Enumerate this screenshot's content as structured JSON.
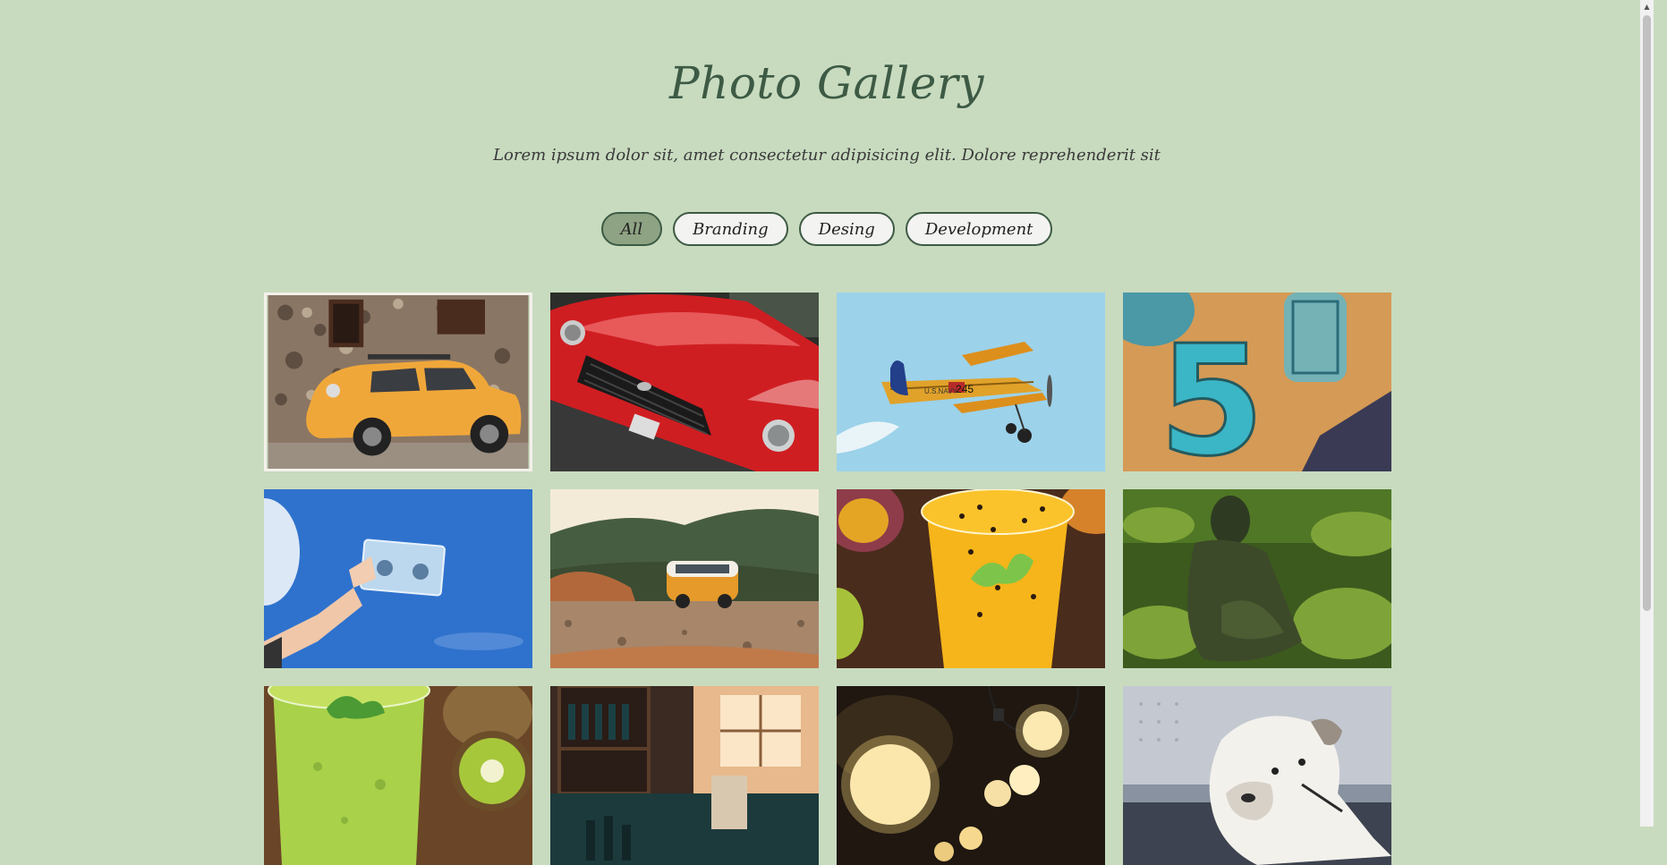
{
  "header": {
    "title": "Photo Gallery",
    "subtitle": "Lorem ipsum dolor sit, amet consectetur adipisicing elit. Dolore reprehenderit sit"
  },
  "filters": [
    {
      "label": "All",
      "active": true
    },
    {
      "label": "Branding",
      "active": false
    },
    {
      "label": "Desing",
      "active": false
    },
    {
      "label": "Development",
      "active": false
    }
  ],
  "gallery": {
    "items": [
      {
        "name": "yellow-vintage-car",
        "selected": true
      },
      {
        "name": "red-mustang"
      },
      {
        "name": "biplane-245"
      },
      {
        "name": "number-five"
      },
      {
        "name": "cassette-in-hand"
      },
      {
        "name": "vw-van-mountains"
      },
      {
        "name": "passion-fruit-drink"
      },
      {
        "name": "mossy-buddha-statue"
      },
      {
        "name": "kiwi-smoothie"
      },
      {
        "name": "rustic-kitchen"
      },
      {
        "name": "string-lights"
      },
      {
        "name": "white-bulldog"
      }
    ],
    "image_texts": {
      "plane_marking": "U.S.NAVY",
      "plane_number": "245",
      "number_sign": "5"
    }
  },
  "colors": {
    "background": "#c8dbbf",
    "title": "#3d5a44",
    "active_filter": "#8ea383",
    "filter_border": "#3d5a44"
  }
}
